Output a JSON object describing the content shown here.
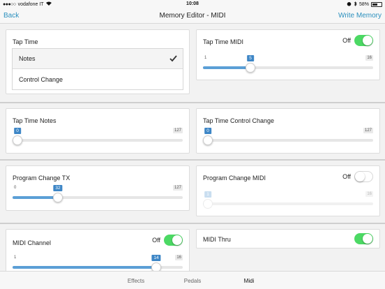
{
  "status": {
    "carrier": "vodafone IT",
    "time": "10:08",
    "battery": "58%"
  },
  "nav": {
    "back": "Back",
    "title": "Memory Editor - MIDI",
    "action": "Write Memory"
  },
  "tap_time": {
    "title": "Tap Time",
    "options": [
      "Notes",
      "Control Change"
    ],
    "selected": "Notes"
  },
  "tap_time_midi": {
    "title": "Tap Time MIDI",
    "toggle_label": "Off",
    "toggle_on": true,
    "min": "1",
    "max": "16",
    "value": "5",
    "fraction": 0.2667
  },
  "tap_time_notes": {
    "title": "Tap Time Notes",
    "min": "",
    "max": "127",
    "value": "0",
    "fraction": 0
  },
  "tap_time_cc": {
    "title": "Tap Time Control Change",
    "min": "",
    "max": "127",
    "value": "0",
    "fraction": 0
  },
  "program_change_tx": {
    "title": "Program Change TX",
    "min": "0",
    "max": "127",
    "value": "32",
    "fraction": 0.252
  },
  "program_change_midi": {
    "title": "Program Change MIDI",
    "toggle_label": "Off",
    "toggle_on": false,
    "min": "",
    "max": "16",
    "value": "1",
    "fraction": 0
  },
  "midi_channel": {
    "title": "MIDI Channel",
    "toggle_label": "Off",
    "toggle_on": true,
    "min": "1",
    "max": "16",
    "value": "14",
    "fraction": 0.8667
  },
  "midi_thru": {
    "title": "MIDI Thru",
    "toggle_on": true
  },
  "tabs": [
    {
      "label": "Effects",
      "active": false
    },
    {
      "label": "Pedals",
      "active": false
    },
    {
      "label": "Midi",
      "active": true
    }
  ],
  "colors": {
    "accent": "#2a8fbd",
    "toggle_on": "#4cd964",
    "slider_fill": "#5b9fd6",
    "value_badge": "#3d86c6"
  }
}
